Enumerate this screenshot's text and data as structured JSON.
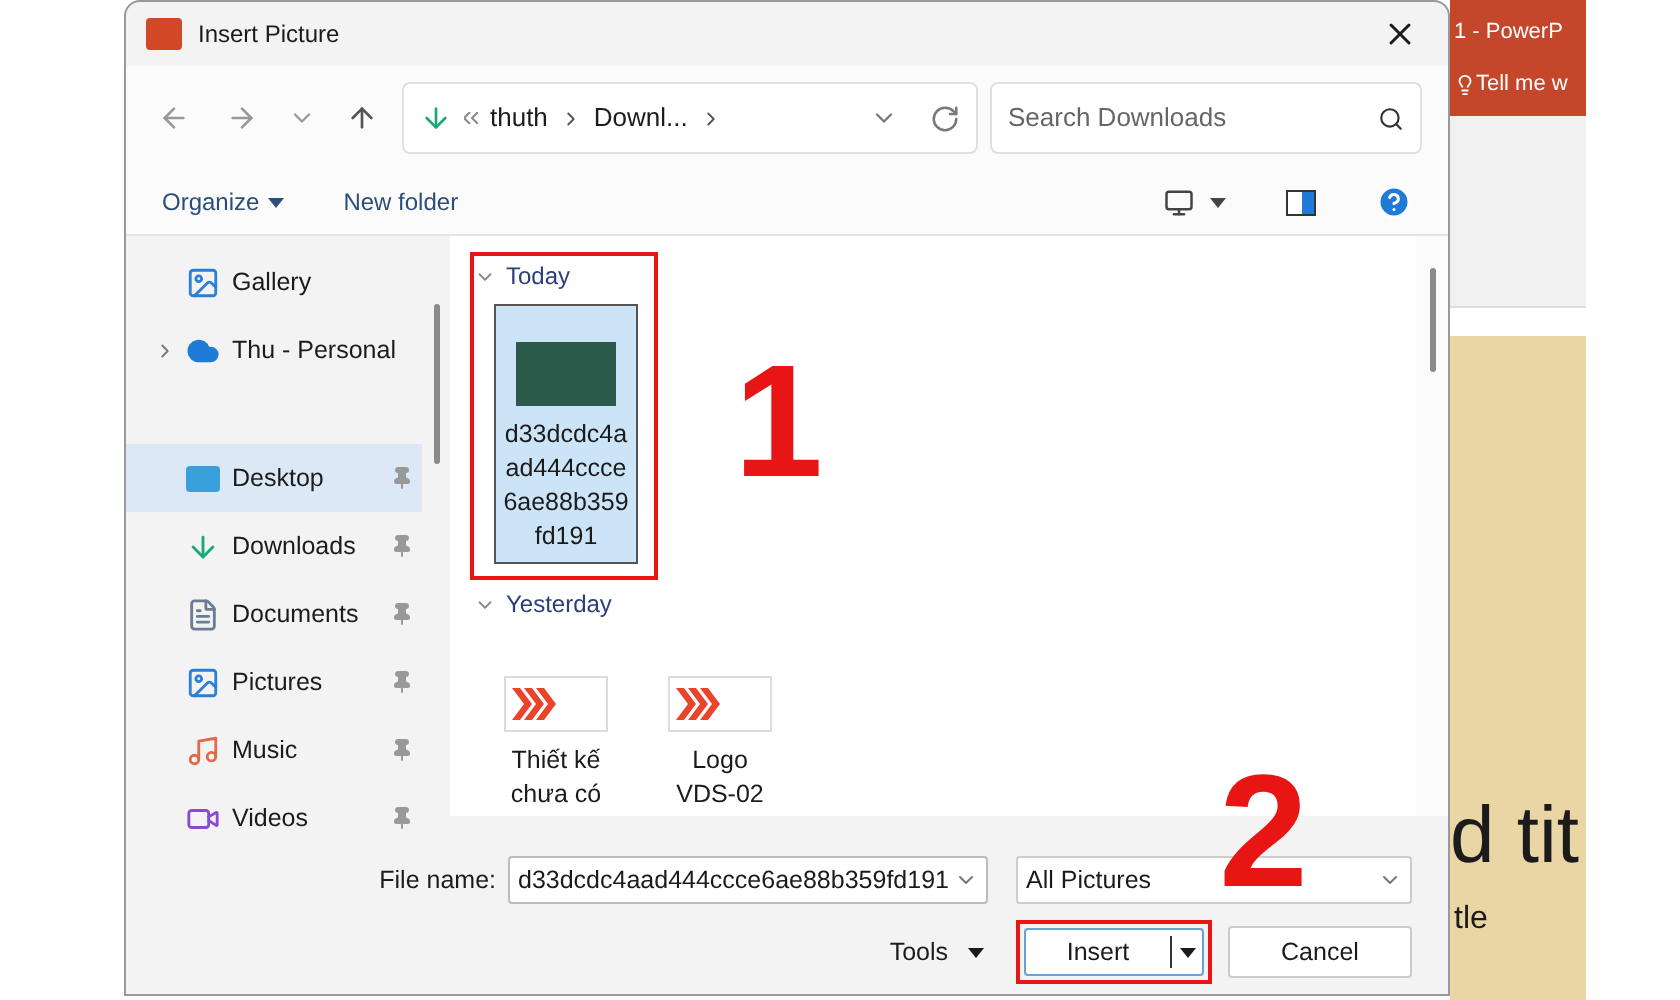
{
  "window": {
    "title": "Insert Picture"
  },
  "address": {
    "crumbs": [
      "thuth",
      "Downl..."
    ]
  },
  "search": {
    "placeholder": "Search Downloads"
  },
  "toolbar": {
    "organize": "Organize",
    "new_folder": "New folder"
  },
  "sidebar": {
    "items": [
      {
        "label": "Gallery",
        "kind": "gallery",
        "pinned": false,
        "selected": false,
        "expandable": false
      },
      {
        "label": "Thu - Personal",
        "kind": "cloud",
        "pinned": false,
        "selected": false,
        "expandable": true
      },
      {
        "label": "Desktop",
        "kind": "desktop",
        "pinned": true,
        "selected": true,
        "expandable": false
      },
      {
        "label": "Downloads",
        "kind": "downloads",
        "pinned": true,
        "selected": false,
        "expandable": false
      },
      {
        "label": "Documents",
        "kind": "documents",
        "pinned": true,
        "selected": false,
        "expandable": false
      },
      {
        "label": "Pictures",
        "kind": "pictures",
        "pinned": true,
        "selected": false,
        "expandable": false
      },
      {
        "label": "Music",
        "kind": "music",
        "pinned": true,
        "selected": false,
        "expandable": false
      },
      {
        "label": "Videos",
        "kind": "videos",
        "pinned": true,
        "selected": false,
        "expandable": false
      }
    ]
  },
  "groups": [
    {
      "label": "Today",
      "highlighted": true,
      "files": [
        {
          "name": "d33dcdc4aad444ccce6ae88b359fd191",
          "kind": "photo",
          "selected": true
        }
      ]
    },
    {
      "label": "Yesterday",
      "highlighted": false,
      "files": [
        {
          "name": "Thiết kế chưa có",
          "kind": "logo",
          "selected": false
        },
        {
          "name": "Logo VDS-02",
          "kind": "logo",
          "selected": false
        }
      ]
    }
  ],
  "annotations": [
    {
      "label": "1"
    },
    {
      "label": "2"
    }
  ],
  "footer": {
    "file_name_label": "File name:",
    "file_name": "d33dcdc4aad444ccce6ae88b359fd191",
    "file_type": "All Pictures",
    "tools": "Tools",
    "insert": "Insert",
    "insert_highlighted": true,
    "cancel": "Cancel"
  },
  "background_app": {
    "title": "1 - PowerP",
    "tell_me": "Tell me w",
    "slide_title": "d tit",
    "slide_subtitle": "tle"
  }
}
